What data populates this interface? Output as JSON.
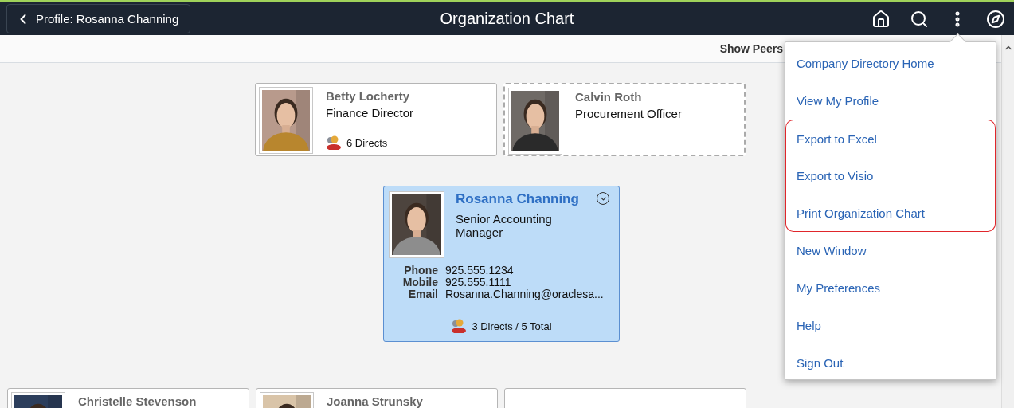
{
  "header": {
    "back_button": "Profile: Rosanna Channing",
    "title": "Organization Chart"
  },
  "toolbar": {
    "show_peers_label": "Show Peers"
  },
  "top_row": [
    {
      "kind": "card",
      "name": "Betty Locherty",
      "job_title": "Finance Director",
      "directs": "6 Directs",
      "dashed": false
    },
    {
      "kind": "card",
      "name": "Calvin Roth",
      "job_title": "Procurement Officer",
      "dashed": true
    }
  ],
  "focus_card": {
    "name": "Rosanna Channing",
    "job_title": "Senior Accounting Manager",
    "details": [
      {
        "label": "Phone",
        "value": "925.555.1234"
      },
      {
        "label": "Mobile",
        "value": "925.555.1111"
      },
      {
        "label": "Email",
        "value": "Rosanna.Channing@oraclesa..."
      }
    ],
    "directs": "3 Directs / 5 Total"
  },
  "bottom_row": [
    {
      "kind": "card",
      "name": "Christelle Stevenson"
    },
    {
      "kind": "card",
      "name": "Joanna Strunsky"
    },
    {
      "kind": "blank"
    }
  ],
  "menu": {
    "items": [
      {
        "label": "Company Directory Home",
        "highlighted": false
      },
      {
        "label": "View My Profile",
        "highlighted": false
      },
      {
        "label": "Export to Excel",
        "highlighted": true
      },
      {
        "label": "Export to Visio",
        "highlighted": true
      },
      {
        "label": "Print Organization Chart",
        "highlighted": true
      },
      {
        "label": "New Window",
        "highlighted": false
      },
      {
        "label": "My Preferences",
        "highlighted": false
      },
      {
        "label": "Help",
        "highlighted": false
      },
      {
        "label": "Sign Out",
        "highlighted": false
      }
    ]
  }
}
